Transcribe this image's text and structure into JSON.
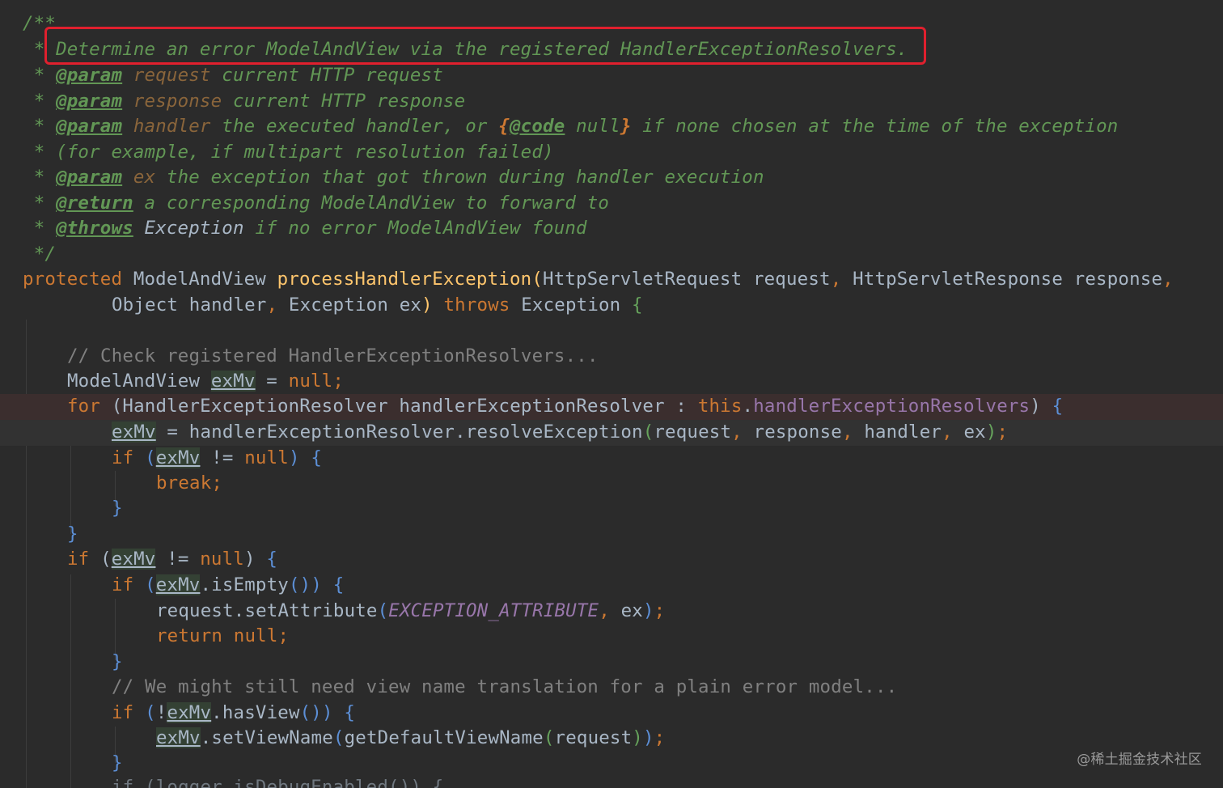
{
  "doc": {
    "open": "/**",
    "star": "*",
    "summary": "Determine an error ModelAndView via the registered HandlerExceptionResolvers.",
    "tags": {
      "param": "@param",
      "return": "@return",
      "throws": "@throws",
      "code": "@code"
    },
    "p_request_name": "request",
    "p_request_desc": " current HTTP request",
    "p_response_name": "response",
    "p_response_desc": " current HTTP response",
    "p_handler_name": "handler",
    "p_handler_desc1": " the executed handler, or ",
    "p_handler_code_open": "{",
    "p_handler_code_null": " null",
    "p_handler_code_close": "}",
    "p_handler_desc2": " if none chosen at the time of the exception",
    "p_handler_cont": "(for example, if multipart resolution failed)",
    "p_ex_name": "ex",
    "p_ex_desc": " the exception that got thrown during handler execution",
    "return_desc": " a corresponding ModelAndView to forward to",
    "throws_type": "Exception",
    "throws_desc": " if no error ModelAndView found",
    "close": "*/"
  },
  "code": {
    "protected": "protected",
    "mav_type": "ModelAndView",
    "method_name": "processHandlerException",
    "paren_open": "(",
    "paren_close": ")",
    "sig1_rest": "HttpServletRequest request",
    "comma": ",",
    "sig1_rest2": " HttpServletResponse response",
    "sig2_a": "Object handler",
    "sig2_b": " Exception ex",
    "throws_kw": "throws",
    "exception_type": "Exception",
    "lbrace": "{",
    "rbrace": "}",
    "comment1": "// Check registered HandlerExceptionResolvers...",
    "decl_type": "ModelAndView ",
    "var_exmv": "exMv",
    "eq": " = ",
    "null_kw": "null",
    "semi": ";",
    "for_kw": "for",
    "for_body": "HandlerExceptionResolver handlerExceptionResolver : ",
    "this_kw": "this",
    "dot": ".",
    "field_resolvers": "handlerExceptionResolvers",
    "resolve_call": "handlerExceptionResolver.resolveException",
    "resolve_args1": "request",
    "resolve_args2": " response",
    "resolve_args3": " handler",
    "resolve_args4": " ex",
    "if_kw": "if",
    "neq": " != ",
    "break_kw": "break",
    "is_empty": "isEmpty",
    "empty_parens": "()",
    "set_attr": "request.setAttribute",
    "exception_attribute": "EXCEPTION_ATTRIBUTE",
    "ex": " ex",
    "return_kw": "return",
    "comment2": "// We might still need view name translation for a plain error model...",
    "not": "!",
    "has_view": "hasView",
    "set_view_name": "setViewName",
    "get_default_view_name": "getDefaultViewName",
    "request": "request",
    "cut_line": "if (logger.isDebugEnabled()) {"
  },
  "watermark": "@稀土掘金技术社区",
  "colors": {
    "background": "#2b2b2b",
    "doc_comment": "#629755",
    "keyword": "#cc7832",
    "method": "#ffc66d",
    "field": "#9876aa",
    "highlight_box": "#e0202e"
  }
}
